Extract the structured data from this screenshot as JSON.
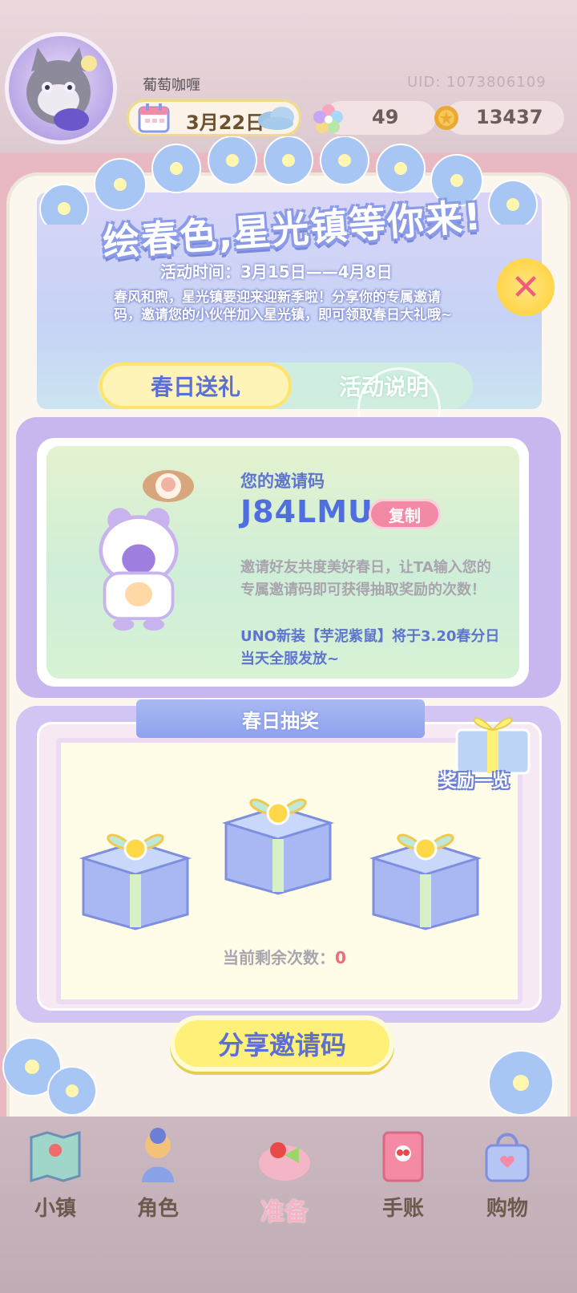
{
  "player": {
    "name": "葡萄咖喱",
    "uid": "UID: 1073806109",
    "date": "3月22日",
    "gems": "49",
    "coins": "13437"
  },
  "event": {
    "title": "绘春色,星光镇等你来!",
    "time": "活动时间：3月15日——4月8日",
    "intro": "春风和煦，星光镇要迎来迎新季啦！分享你的专属邀请码，邀请您的小伙伴加入星光镇，即可领取春日大礼哦~",
    "close_icon": "close-icon"
  },
  "tabs": {
    "active": "春日送礼",
    "info": "活动说明"
  },
  "invite": {
    "label": "您的邀请码",
    "code": "J84LMU",
    "copy": "复制",
    "desc": "邀请好友共度美好春日，让TA输入您的专属邀请码即可获得抽取奖励的次数！",
    "notice": "UNO新装【芋泥紫鼠】将于3.20春分日当天全服发放~"
  },
  "lottery": {
    "title": "春日抽奖",
    "reward_list": "奖励一览",
    "remaining_label": "当前剩余次数：",
    "remaining_count": "0"
  },
  "share_button": "分享邀请码",
  "nav": [
    {
      "label": "小镇",
      "icon": "map-icon"
    },
    {
      "label": "角色",
      "icon": "character-icon"
    },
    {
      "label": "准备",
      "icon": "prepare-icon"
    },
    {
      "label": "手账",
      "icon": "journal-icon"
    },
    {
      "label": "购物",
      "icon": "shopping-bag-icon"
    }
  ],
  "colors": {
    "accent_blue": "#5b6fd6",
    "accent_pink": "#f38aa5",
    "yellow": "#fff07a"
  }
}
